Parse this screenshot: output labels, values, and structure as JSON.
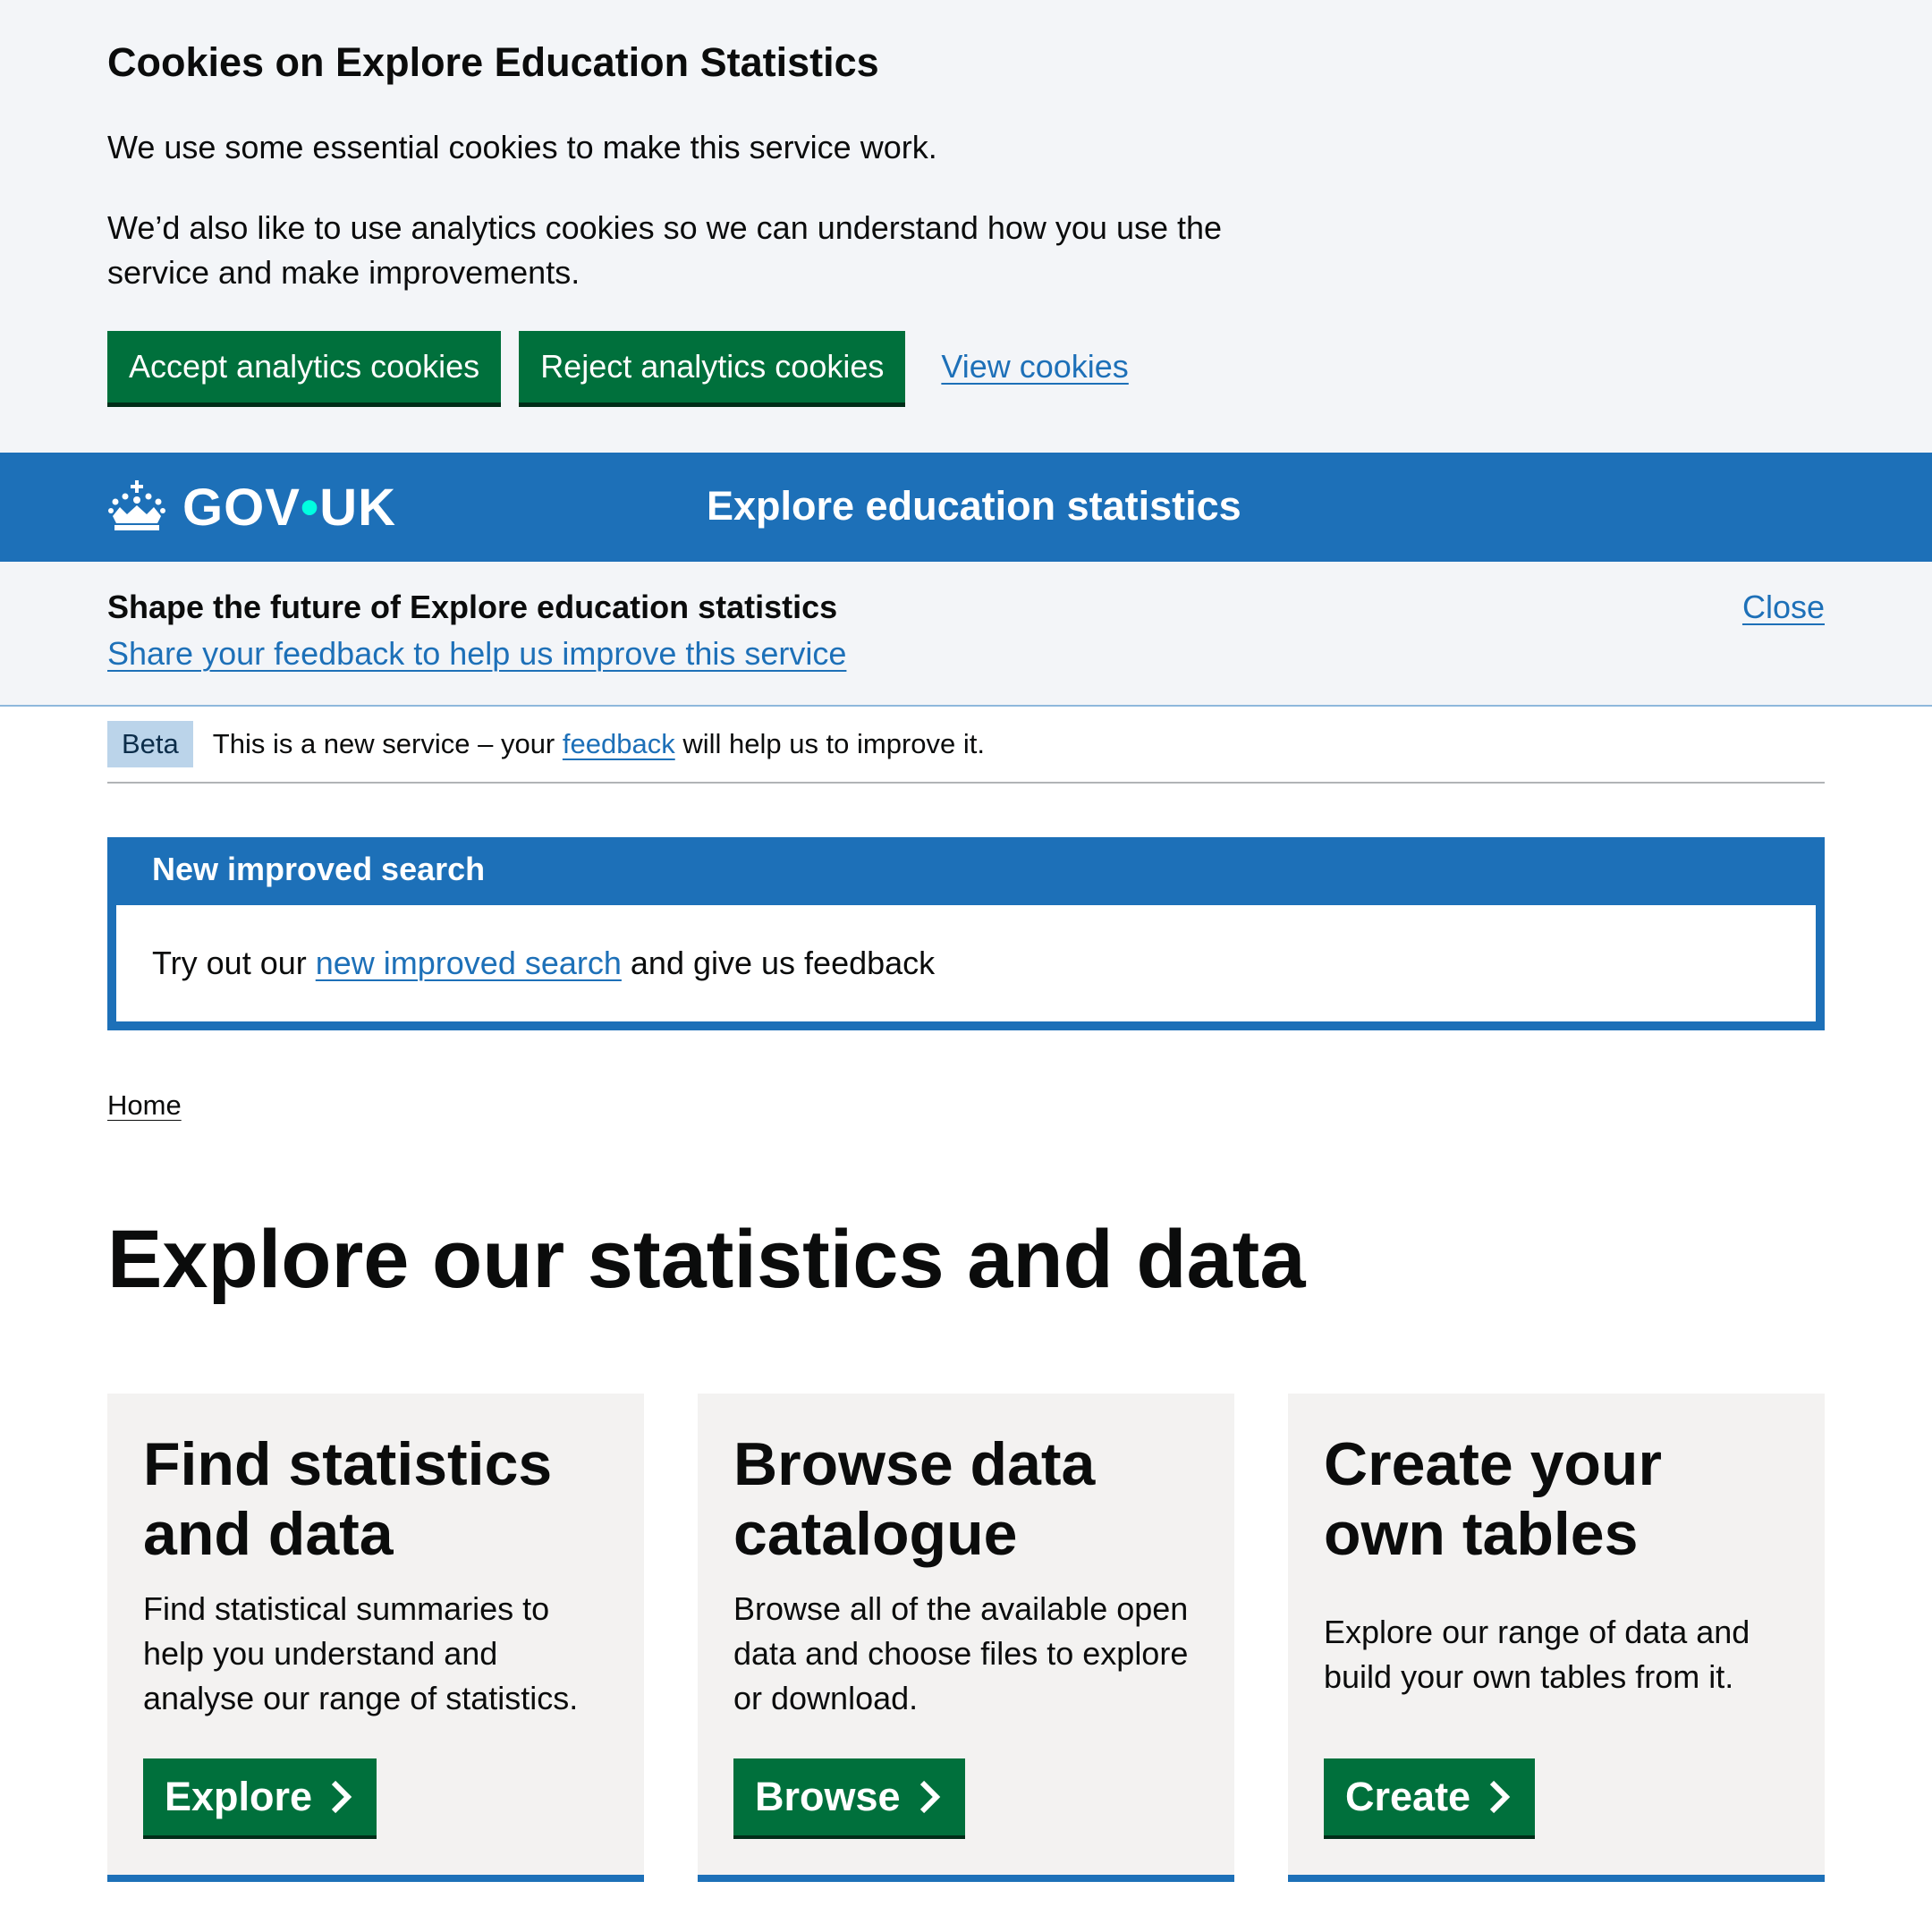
{
  "cookie_banner": {
    "title": "Cookies on Explore Education Statistics",
    "text1": "We use some essential cookies to make this service work.",
    "text2": "We’d also like to use analytics cookies so we can understand how you use the service and make improvements.",
    "accept_label": "Accept analytics cookies",
    "reject_label": "Reject analytics cookies",
    "view_label": "View cookies"
  },
  "header": {
    "logo_gov": "GOV",
    "logo_dot": "•",
    "logo_uk": "UK",
    "service_name": "Explore education statistics"
  },
  "survey": {
    "title": "Shape the future of Explore education statistics",
    "link": "Share your feedback to help us improve this service",
    "close": "Close"
  },
  "phase": {
    "tag": "Beta",
    "text_before": "This is a new service – your ",
    "link": "feedback",
    "text_after": " will help us to improve it."
  },
  "notice": {
    "title": "New improved search",
    "text_before": "Try out our ",
    "link": "new improved search",
    "text_after": " and give us feedback"
  },
  "breadcrumb": {
    "home": "Home"
  },
  "page_title": "Explore our statistics and data",
  "cards": [
    {
      "title": "Find statistics and data",
      "description": "Find statistical summaries to help you understand and analyse our range of statistics.",
      "button": "Explore"
    },
    {
      "title": "Browse data catalogue",
      "description": "Browse all of the available open data and choose files to explore or download.",
      "button": "Browse"
    },
    {
      "title": "Create your own tables",
      "description": "Explore our range of data and build your own tables from it.",
      "button": "Create"
    }
  ],
  "colors": {
    "brand_blue": "#1d70b8",
    "button_green": "#00703c",
    "banner_bg": "#f3f5f8",
    "card_bg": "#f3f2f1"
  }
}
